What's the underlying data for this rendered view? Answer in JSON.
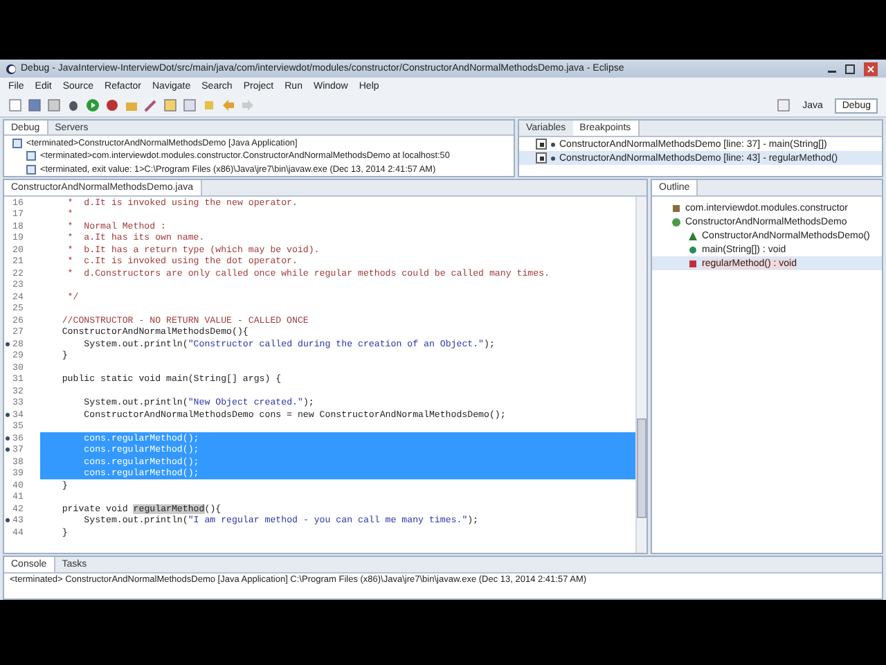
{
  "window": {
    "title": "Debug - JavaInterview-InterviewDot/src/main/java/com/interviewdot/modules/constructor/ConstructorAndNormalMethodsDemo.java - Eclipse"
  },
  "menu": [
    "File",
    "Edit",
    "Source",
    "Refactor",
    "Navigate",
    "Search",
    "Project",
    "Run",
    "Window",
    "Help"
  ],
  "perspectives": [
    {
      "label": "Java",
      "selected": false
    },
    {
      "label": "Debug",
      "selected": true
    }
  ],
  "debug_view": {
    "tabs": [
      {
        "label": "Debug",
        "selected": true
      },
      {
        "label": "Servers",
        "selected": false
      }
    ],
    "tree": [
      {
        "text": "<terminated>ConstructorAndNormalMethodsDemo [Java Application]",
        "children": [
          {
            "text": "<terminated>com.interviewdot.modules.constructor.ConstructorAndNormalMethodsDemo at localhost:50"
          },
          {
            "text": "<terminated, exit value: 1>C:\\Program Files (x86)\\Java\\jre7\\bin\\javaw.exe (Dec 13, 2014 2:41:57 AM)"
          }
        ]
      }
    ]
  },
  "breakpoints_view": {
    "tabs": [
      {
        "label": "Variables",
        "selected": false
      },
      {
        "label": "Breakpoints",
        "selected": true
      }
    ],
    "items": [
      {
        "text": "ConstructorAndNormalMethodsDemo [line: 37] - main(String[])",
        "checked": true,
        "selected": false
      },
      {
        "text": "ConstructorAndNormalMethodsDemo [line: 43] - regularMethod()",
        "checked": true,
        "selected": true
      }
    ]
  },
  "editor": {
    "tab": "ConstructorAndNormalMethodsDemo.java",
    "lines": [
      {
        "number": "16",
        "breakpoint": false,
        "selected": false,
        "segments": [
          {
            "kind": "comment",
            "text": "     *  d.It is invoked using the new operator."
          }
        ]
      },
      {
        "number": "17",
        "breakpoint": false,
        "selected": false,
        "segments": [
          {
            "kind": "comment",
            "text": "     *"
          }
        ]
      },
      {
        "number": "18",
        "breakpoint": false,
        "selected": false,
        "segments": [
          {
            "kind": "comment",
            "text": "     *  Normal Method :"
          }
        ]
      },
      {
        "number": "19",
        "breakpoint": false,
        "selected": false,
        "segments": [
          {
            "kind": "comment",
            "text": "     *  a.It has its own name."
          }
        ]
      },
      {
        "number": "20",
        "breakpoint": false,
        "selected": false,
        "segments": [
          {
            "kind": "comment",
            "text": "     *  b.It has a return type (which may be void)."
          }
        ]
      },
      {
        "number": "21",
        "breakpoint": false,
        "selected": false,
        "segments": [
          {
            "kind": "comment",
            "text": "     *  c.It is invoked using the dot operator."
          }
        ]
      },
      {
        "number": "22",
        "breakpoint": false,
        "selected": false,
        "segments": [
          {
            "kind": "comment",
            "text": "     *  d.Constructors are only called once while regular methods could be called many times."
          }
        ]
      },
      {
        "number": "23",
        "breakpoint": false,
        "selected": false
      },
      {
        "number": "24",
        "breakpoint": false,
        "selected": false,
        "segments": [
          {
            "kind": "comment",
            "text": "     */"
          }
        ]
      },
      {
        "number": "25",
        "breakpoint": false,
        "selected": false
      },
      {
        "number": "26",
        "breakpoint": false,
        "selected": false,
        "segments": [
          {
            "kind": "comment",
            "text": "    //CONSTRUCTOR - NO RETURN VALUE - CALLED ONCE"
          }
        ]
      },
      {
        "number": "27",
        "breakpoint": false,
        "selected": false,
        "segments": [
          {
            "kind": "plain",
            "text": "    ConstructorAndNormalMethodsDemo(){"
          }
        ]
      },
      {
        "number": "28",
        "breakpoint": true,
        "selected": false,
        "segments": [
          {
            "kind": "plain",
            "text": "        System.out.println("
          },
          {
            "kind": "string",
            "text": "\"Constructor called during the creation of an Object.\""
          },
          {
            "kind": "plain",
            "text": ");"
          }
        ]
      },
      {
        "number": "29",
        "breakpoint": false,
        "selected": false,
        "segments": [
          {
            "kind": "plain",
            "text": "    }"
          }
        ]
      },
      {
        "number": "30",
        "breakpoint": false,
        "selected": false
      },
      {
        "number": "31",
        "breakpoint": false,
        "selected": false,
        "segments": [
          {
            "kind": "plain",
            "text": "    public static void main(String[] args) {"
          }
        ]
      },
      {
        "number": "32",
        "breakpoint": false,
        "selected": false
      },
      {
        "number": "33",
        "breakpoint": false,
        "selected": false,
        "segments": [
          {
            "kind": "plain",
            "text": "        System.out.println("
          },
          {
            "kind": "string",
            "text": "\"New Object created.\""
          },
          {
            "kind": "plain",
            "text": ");"
          }
        ]
      },
      {
        "number": "34",
        "breakpoint": true,
        "selected": false,
        "segments": [
          {
            "kind": "plain",
            "text": "        ConstructorAndNormalMethodsDemo cons = new ConstructorAndNormalMethodsDemo();"
          }
        ]
      },
      {
        "number": "35",
        "breakpoint": false,
        "selected": false
      },
      {
        "number": "36",
        "breakpoint": true,
        "selected": true,
        "segments": [
          {
            "kind": "plain",
            "text": "        cons.regularMethod();"
          }
        ]
      },
      {
        "number": "37",
        "breakpoint": true,
        "selected": true,
        "segments": [
          {
            "kind": "plain",
            "text": "        cons.regularMethod();"
          }
        ]
      },
      {
        "number": "38",
        "breakpoint": false,
        "selected": true,
        "segments": [
          {
            "kind": "plain",
            "text": "        cons.regularMethod();"
          }
        ]
      },
      {
        "number": "39",
        "breakpoint": false,
        "selected": true,
        "segments": [
          {
            "kind": "plain",
            "text": "        cons.regularMethod();"
          }
        ]
      },
      {
        "number": "40",
        "breakpoint": false,
        "selected": false,
        "segments": [
          {
            "kind": "plain",
            "text": "    }"
          }
        ]
      },
      {
        "number": "41",
        "breakpoint": false,
        "selected": false
      },
      {
        "number": "42",
        "breakpoint": false,
        "selected": false,
        "segments": [
          {
            "kind": "plain",
            "text": "    private void "
          },
          {
            "kind": "highlight",
            "text": "regularMethod"
          },
          {
            "kind": "plain",
            "text": "(){"
          }
        ]
      },
      {
        "number": "43",
        "breakpoint": true,
        "selected": false,
        "segments": [
          {
            "kind": "plain",
            "text": "        System.out.println("
          },
          {
            "kind": "string",
            "text": "\"I am regular method - you can call me many times.\""
          },
          {
            "kind": "plain",
            "text": ");"
          }
        ]
      },
      {
        "number": "44",
        "breakpoint": false,
        "selected": false,
        "segments": [
          {
            "kind": "plain",
            "text": "    }"
          }
        ]
      }
    ]
  },
  "outline": {
    "tab": "Outline",
    "items": [
      {
        "kind": "package",
        "text": "com.interviewdot.modules.constructor",
        "selected": false
      },
      {
        "kind": "class",
        "text": "ConstructorAndNormalMethodsDemo",
        "selected": false,
        "children": [
          {
            "kind": "constructor",
            "text": "ConstructorAndNormalMethodsDemo()",
            "selected": false
          },
          {
            "kind": "static-method",
            "text": "main(String[]) : void",
            "selected": false
          },
          {
            "kind": "private-method",
            "text": "regularMethod() : void",
            "selected": true
          }
        ]
      }
    ]
  },
  "console": {
    "tabs": [
      {
        "label": "Console",
        "selected": true
      },
      {
        "label": "Tasks",
        "selected": false
      }
    ],
    "text": "<terminated> ConstructorAndNormalMethodsDemo [Java Application] C:\\Program Files (x86)\\Java\\jre7\\bin\\javaw.exe (Dec 13, 2014 2:41:57 AM)"
  }
}
